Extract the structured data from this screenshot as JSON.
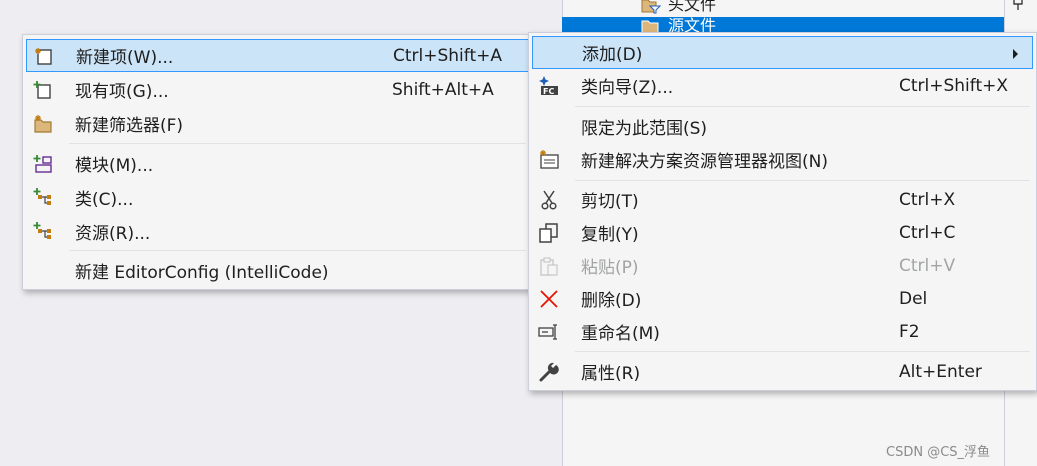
{
  "tree": {
    "row1_label": "头文件",
    "row2_label": "源文件"
  },
  "main_menu": {
    "add": {
      "label": "添加(D)",
      "shortcut": ""
    },
    "class_wizard": {
      "label": "类向导(Z)...",
      "shortcut": "Ctrl+Shift+X"
    },
    "scope": {
      "label": "限定为此范围(S)",
      "shortcut": ""
    },
    "new_view": {
      "label": "新建解决方案资源管理器视图(N)",
      "shortcut": ""
    },
    "cut": {
      "label": "剪切(T)",
      "shortcut": "Ctrl+X"
    },
    "copy": {
      "label": "复制(Y)",
      "shortcut": "Ctrl+C"
    },
    "paste": {
      "label": "粘贴(P)",
      "shortcut": "Ctrl+V"
    },
    "delete": {
      "label": "删除(D)",
      "shortcut": "Del"
    },
    "rename": {
      "label": "重命名(M)",
      "shortcut": "F2"
    },
    "properties": {
      "label": "属性(R)",
      "shortcut": "Alt+Enter"
    }
  },
  "sub_menu": {
    "new_item": {
      "label": "新建项(W)...",
      "shortcut": "Ctrl+Shift+A"
    },
    "existing_item": {
      "label": "现有项(G)...",
      "shortcut": "Shift+Alt+A"
    },
    "new_filter": {
      "label": "新建筛选器(F)",
      "shortcut": ""
    },
    "module": {
      "label": "模块(M)...",
      "shortcut": ""
    },
    "class": {
      "label": "类(C)...",
      "shortcut": ""
    },
    "resource": {
      "label": "资源(R)...",
      "shortcut": ""
    },
    "editorconfig": {
      "label": "新建 EditorConfig (IntelliCode)",
      "shortcut": ""
    }
  },
  "icons": {
    "new_item": "new-item-icon",
    "existing_item": "existing-item-icon",
    "new_filter": "new-folder-icon",
    "module": "module-icon",
    "class": "class-icon",
    "resource": "resource-icon",
    "class_wizard": "class-wizard-icon",
    "new_view": "new-view-icon",
    "cut": "scissors-icon",
    "copy": "copy-icon",
    "paste": "paste-icon",
    "delete": "delete-icon",
    "rename": "rename-icon",
    "properties": "wrench-icon"
  },
  "colors": {
    "highlight_bg": "#cce4f7",
    "highlight_border": "#3399ff",
    "selection": "#0078d7",
    "disabled_text": "#a2a4a5"
  },
  "watermark": "CSDN @CS_浮鱼"
}
